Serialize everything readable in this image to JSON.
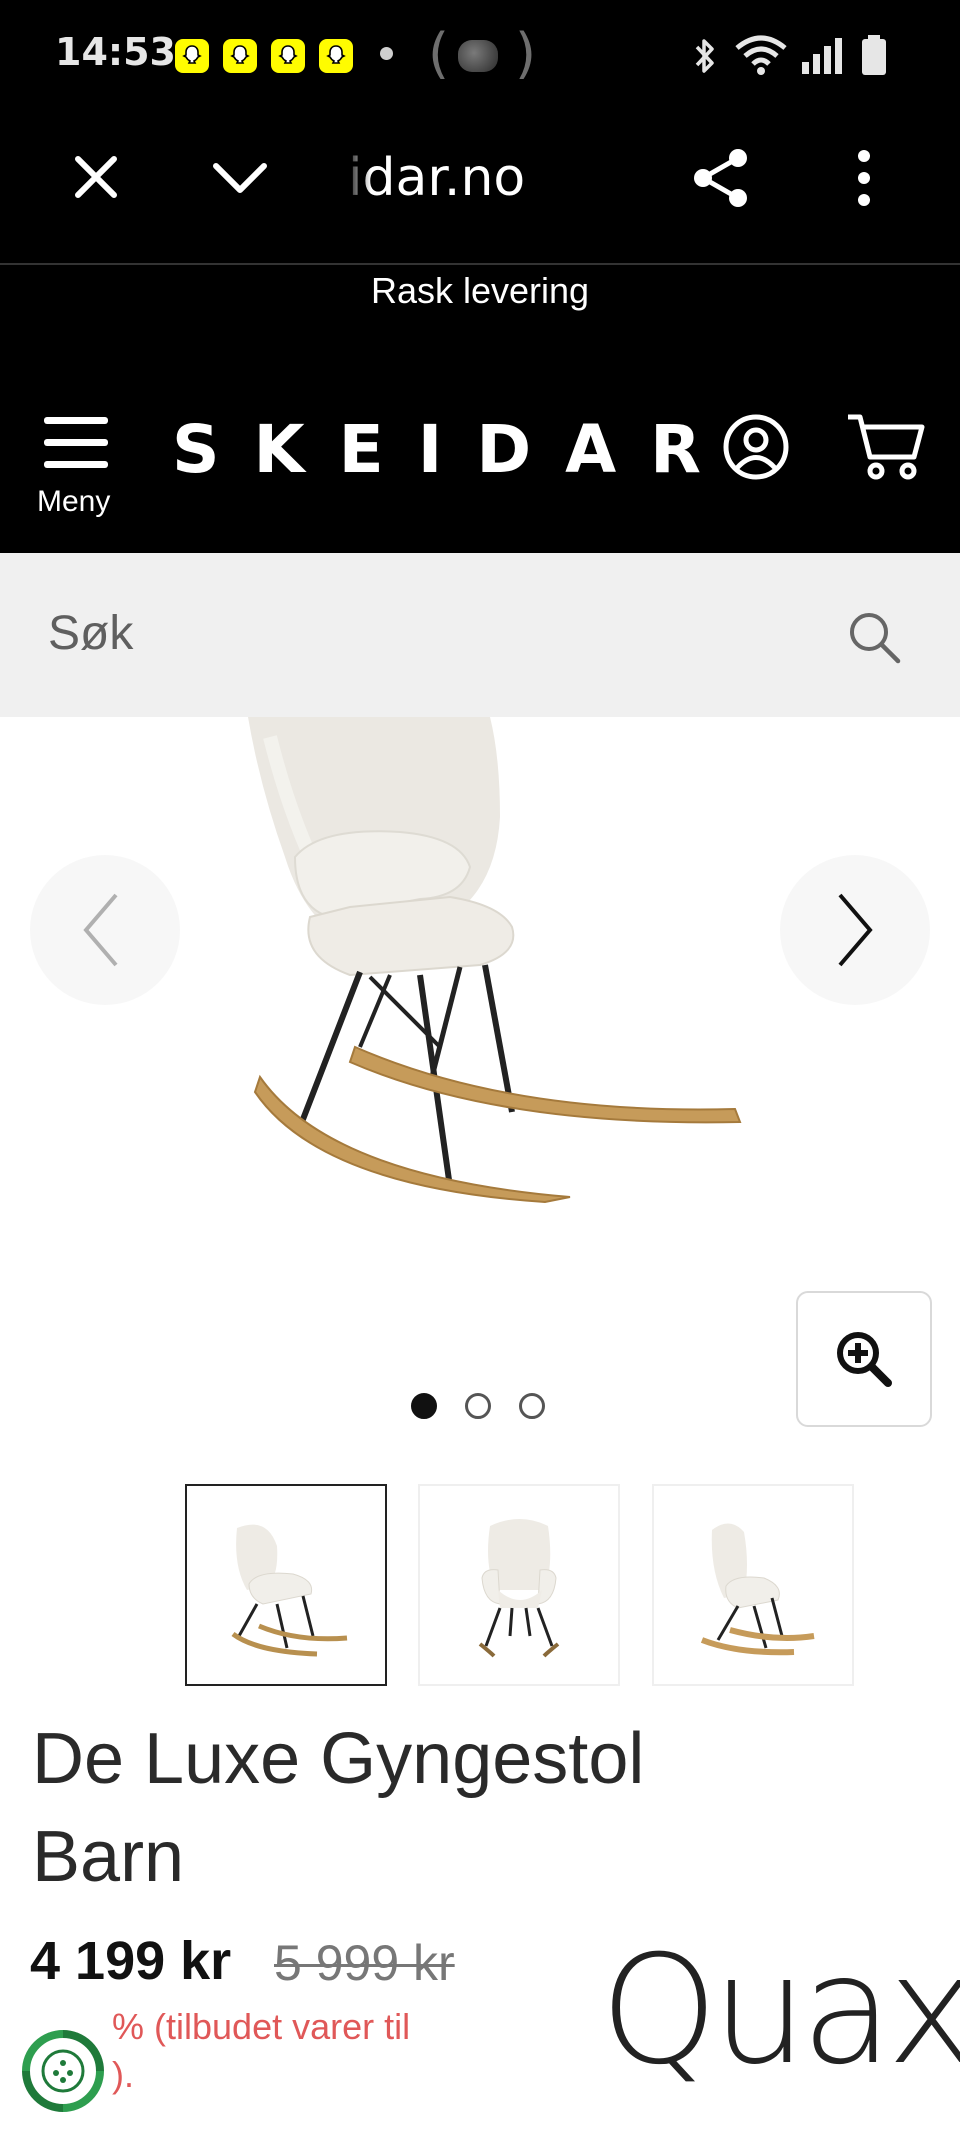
{
  "status_bar": {
    "time": "14:53",
    "icons": [
      "snapchat-icon",
      "snapchat-icon",
      "snapchat-icon",
      "snapchat-icon",
      "dot-icon",
      "cast-icon",
      "bluetooth-icon",
      "wifi-icon",
      "signal-icon",
      "battery-icon"
    ]
  },
  "browser": {
    "url": "idar.no",
    "icons": [
      "close-icon",
      "chevron-down-icon",
      "share-icon",
      "more-vert-icon"
    ]
  },
  "promo": {
    "text": "Rask levering"
  },
  "header": {
    "menu_label": "Meny",
    "logo": "SKEIDAR",
    "icons": [
      "hamburger-icon",
      "account-icon",
      "cart-icon"
    ]
  },
  "search": {
    "placeholder": "Søk",
    "icon": "search-icon"
  },
  "gallery": {
    "image_alt": "De Luxe Gyngestol Barn",
    "slide_count": 3,
    "active_slide": 1,
    "icons": [
      "chevron-left-icon",
      "chevron-right-icon",
      "zoom-in-icon"
    ]
  },
  "product": {
    "title": "De Luxe Gyngestol Barn",
    "price": "4 199 kr",
    "old_price": "5 999 kr",
    "discount_line1": "% (tilbudet varer til",
    "discount_line2": ").",
    "brand": "Quax"
  },
  "colors": {
    "background_dark": "#000000",
    "search_bg": "#f0f0f0",
    "discount_red": "#e05858",
    "snapchat_yellow": "#fffc00"
  }
}
